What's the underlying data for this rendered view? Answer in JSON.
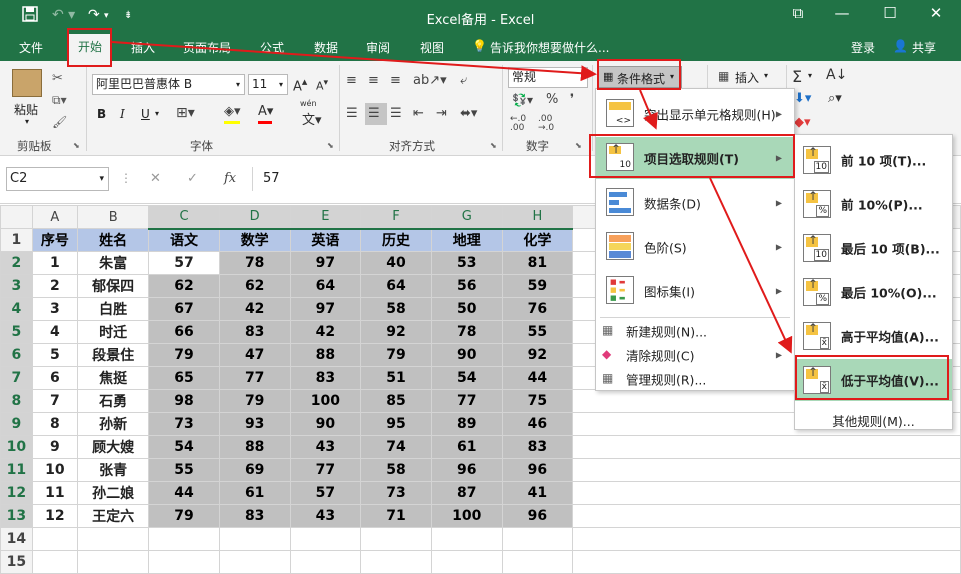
{
  "window": {
    "title": "Excel备用 - Excel",
    "redo_label": "↷",
    "user_login": "登录",
    "share_label": "共享"
  },
  "tabs": [
    "文件",
    "开始",
    "插入",
    "页面布局",
    "公式",
    "数据",
    "审阅",
    "视图"
  ],
  "tell_me": "告诉我你想要做什么...",
  "ribbon": {
    "paste": "粘贴",
    "clipboard_group": "剪贴板",
    "font_name": "阿里巴巴普惠体 B",
    "font_size": "11",
    "font_group": "字体",
    "align_group": "对齐方式",
    "number_format": "常规",
    "number_group": "数字",
    "cond_format": "条件格式",
    "insert": "插入",
    "percent": "%",
    "bold": "B",
    "italic": "I",
    "underline": "U",
    "sum_label": "Σ",
    "wen": "wén",
    "dec_inc": "←.0\n.00",
    "dec_dec": ".00\n→.0"
  },
  "formula": {
    "name_box": "C2",
    "fx": "fx",
    "value": "57"
  },
  "sheet": {
    "columns": [
      "A",
      "B",
      "C",
      "D",
      "E",
      "F",
      "G",
      "H"
    ],
    "row_numbers": [
      "1",
      "2",
      "3",
      "4",
      "5",
      "6",
      "7",
      "8",
      "9",
      "10",
      "11",
      "12",
      "13",
      "14",
      "15"
    ],
    "headers": [
      "序号",
      "姓名",
      "语文",
      "数学",
      "英语",
      "历史",
      "地理",
      "化学"
    ],
    "rows": [
      [
        "1",
        "朱富",
        "57",
        "78",
        "97",
        "40",
        "53",
        "81"
      ],
      [
        "2",
        "郁保四",
        "62",
        "62",
        "64",
        "64",
        "56",
        "59"
      ],
      [
        "3",
        "白胜",
        "67",
        "42",
        "97",
        "58",
        "50",
        "76"
      ],
      [
        "4",
        "时迁",
        "66",
        "83",
        "42",
        "92",
        "78",
        "55"
      ],
      [
        "5",
        "段景住",
        "79",
        "47",
        "88",
        "79",
        "90",
        "92"
      ],
      [
        "6",
        "焦挺",
        "65",
        "77",
        "83",
        "51",
        "54",
        "44"
      ],
      [
        "7",
        "石勇",
        "98",
        "79",
        "100",
        "85",
        "77",
        "75"
      ],
      [
        "8",
        "孙新",
        "73",
        "93",
        "90",
        "95",
        "89",
        "46"
      ],
      [
        "9",
        "顾大嫂",
        "54",
        "88",
        "43",
        "74",
        "61",
        "83"
      ],
      [
        "10",
        "张青",
        "55",
        "69",
        "77",
        "58",
        "96",
        "96"
      ],
      [
        "11",
        "孙二娘",
        "44",
        "61",
        "57",
        "73",
        "87",
        "41"
      ],
      [
        "12",
        "王定六",
        "79",
        "83",
        "43",
        "71",
        "100",
        "96"
      ]
    ]
  },
  "menu": {
    "items": [
      {
        "label": "突出显示单元格规则(H)",
        "has_sub": true
      },
      {
        "label": "项目选取规则(T)",
        "has_sub": true
      },
      {
        "label": "数据条(D)",
        "has_sub": true
      },
      {
        "label": "色阶(S)",
        "has_sub": true
      },
      {
        "label": "图标集(I)",
        "has_sub": true
      }
    ],
    "small_items": [
      "新建规则(N)...",
      "清除规则(C)",
      "管理规则(R)..."
    ]
  },
  "submenu": {
    "items": [
      "前 10 项(T)...",
      "前 10%(P)...",
      "最后 10 项(B)...",
      "最后 10%(O)...",
      "高于平均值(A)...",
      "低于平均值(V)..."
    ],
    "more": "其他规则(M)...",
    "icon_labels": [
      "10",
      "%",
      "10",
      "%",
      "x̄",
      "x̄"
    ]
  },
  "colors": {
    "accent": "#217346",
    "highlight_red": "#e01b1b",
    "menu_hover": "#a9d8b8"
  }
}
